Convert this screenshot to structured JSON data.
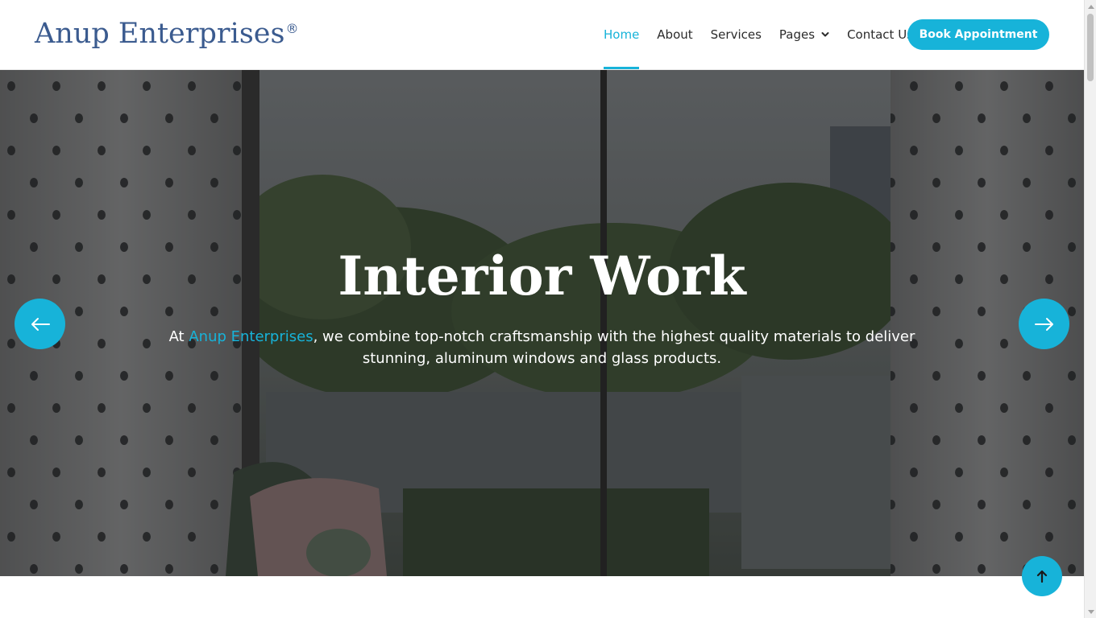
{
  "header": {
    "logo": "Anup Enterprises",
    "logo_mark": "®",
    "nav": {
      "home": "Home",
      "about": "About",
      "services": "Services",
      "pages": "Pages",
      "contact": "Contact Us"
    },
    "active_nav": "Home",
    "cta": "Book Appointment"
  },
  "hero": {
    "title": "Interior Work",
    "text_prefix": "At ",
    "text_highlight": "Anup Enterprises",
    "text_suffix": ", we combine top-notch craftsmanship with the highest quality materials to deliver stunning, aluminum windows and glass products."
  },
  "icons": {
    "prev": "arrow-left-icon",
    "next": "arrow-right-icon",
    "to_top": "arrow-up-icon",
    "pages_dropdown": "chevron-down-icon"
  },
  "colors": {
    "accent": "#17b3d9",
    "logo": "#3b5b8f",
    "nav_text": "#2b2b2b",
    "white": "#ffffff"
  }
}
